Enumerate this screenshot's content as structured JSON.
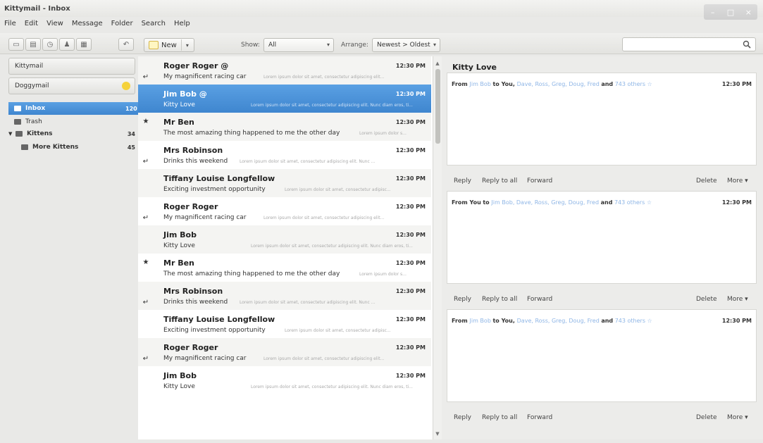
{
  "window": {
    "title": "Kittymail - Inbox"
  },
  "menu": [
    "File",
    "Edit",
    "View",
    "Message",
    "Folder",
    "Search",
    "Help"
  ],
  "toolbar": {
    "new_label": "New",
    "show_label": "Show:",
    "show_value": "All",
    "arrange_label": "Arrange:",
    "arrange_value": "Newest > Oldest",
    "search_placeholder": ""
  },
  "sidebar": {
    "accounts": [
      "Kittymail",
      "Doggymail"
    ],
    "folders": [
      {
        "name": "Inbox",
        "count": "120"
      },
      {
        "name": "Trash",
        "count": ""
      },
      {
        "name": "Kittens",
        "count": "34"
      },
      {
        "name": "More Kittens",
        "count": "45"
      }
    ]
  },
  "messages": [
    {
      "sender": "Roger Roger @",
      "time": "12:30 PM",
      "subject": "My magnificent racing car",
      "preview": "Lorem ipsum dolor sit amet, consectetur adipiscing elit...",
      "mark": "reply",
      "selected": false
    },
    {
      "sender": "Jim Bob @",
      "time": "12:30 PM",
      "subject": "Kitty Love",
      "preview": "Lorem ipsum dolor sit amet, consectetur adipiscing elit. Nunc diam eros, ti...",
      "mark": "",
      "selected": true
    },
    {
      "sender": "Mr Ben",
      "time": "12:30 PM",
      "subject": "The most amazing thing happened to me the other day",
      "preview": "Lorem ipsum dolor s...",
      "mark": "star",
      "selected": false
    },
    {
      "sender": "Mrs Robinson",
      "time": "12:30 PM",
      "subject": "Drinks this weekend",
      "preview": "Lorem ipsum dolor sit amet, consectetur adipiscing elit. Nunc ...",
      "mark": "reply",
      "selected": false
    },
    {
      "sender": "Tiffany Louise Longfellow",
      "time": "12:30 PM",
      "subject": "Exciting investment opportunity",
      "preview": "Lorem ipsum dolor sit amet, consectetur adipisc...",
      "mark": "",
      "selected": false
    },
    {
      "sender": "Roger Roger",
      "time": "12:30 PM",
      "subject": "My magnificent racing car",
      "preview": "Lorem ipsum dolor sit amet, consectetur adipiscing elit...",
      "mark": "reply",
      "selected": false
    },
    {
      "sender": "Jim Bob",
      "time": "12:30 PM",
      "subject": "Kitty Love",
      "preview": "Lorem ipsum dolor sit amet, consectetur adipiscing elit. Nunc diam eros, ti...",
      "mark": "",
      "selected": false
    },
    {
      "sender": "Mr Ben",
      "time": "12:30 PM",
      "subject": "The most amazing thing happened to me the other day",
      "preview": "Lorem ipsum dolor s...",
      "mark": "star",
      "selected": false
    },
    {
      "sender": "Mrs Robinson",
      "time": "12:30 PM",
      "subject": "Drinks this weekend",
      "preview": "Lorem ipsum dolor sit amet, consectetur adipiscing elit. Nunc ...",
      "mark": "reply",
      "selected": false
    },
    {
      "sender": "Tiffany Louise Longfellow",
      "time": "12:30 PM",
      "subject": "Exciting investment opportunity",
      "preview": "Lorem ipsum dolor sit amet, consectetur adipisc...",
      "mark": "",
      "selected": false
    },
    {
      "sender": "Roger Roger",
      "time": "12:30 PM",
      "subject": "My magnificent racing car",
      "preview": "Lorem ipsum dolor sit amet, consectetur adipiscing elit...",
      "mark": "reply",
      "selected": false
    },
    {
      "sender": "Jim Bob",
      "time": "12:30 PM",
      "subject": "Kitty Love",
      "preview": "Lorem ipsum dolor sit amet, consectetur adipiscing elit. Nunc diam eros, ti...",
      "mark": "",
      "selected": false
    }
  ],
  "conversation": {
    "title": "Kitty Love",
    "messages": [
      {
        "from": "Jim Bob",
        "to": "You",
        "cc": "Dave, Ross, Greg, Doug, Fred",
        "and_label": "and",
        "others": "743 others",
        "time": "12:30 PM"
      },
      {
        "from": "You",
        "to": "Jim Bob",
        "cc": ", Dave, Ross, Greg, Doug, Fred",
        "and_label": "and",
        "others": "743 others",
        "time": "12:30 PM"
      },
      {
        "from": "Jim Bob",
        "to": "You",
        "cc": "Dave, Ross, Greg, Doug, Fred",
        "and_label": "and",
        "others": "743 others",
        "time": "12:30 PM"
      }
    ],
    "actions": {
      "reply": "Reply",
      "reply_all": "Reply to all",
      "forward": "Forward",
      "delete": "Delete",
      "more": "More ▾"
    }
  },
  "colors": {
    "selection": "#4a93da",
    "link": "#8fb6e6",
    "star_badge": "#f5d23b"
  }
}
